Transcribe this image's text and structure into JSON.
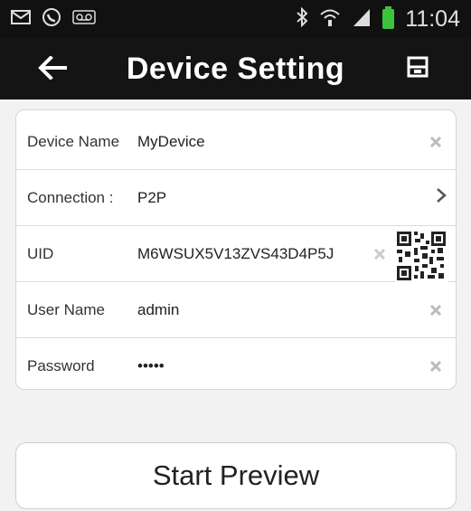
{
  "statusbar": {
    "time": "11:04",
    "icons": [
      "message-icon",
      "missed-call-icon",
      "voicemail-icon",
      "bluetooth-icon",
      "wifi-icon",
      "signal-icon",
      "battery-icon"
    ]
  },
  "header": {
    "title": "Device Setting",
    "back_icon": "arrow-left-icon",
    "save_icon": "save-icon"
  },
  "form": {
    "device_name": {
      "label": "Device Name",
      "value": "MyDevice"
    },
    "connection": {
      "label": "Connection  :",
      "value": "P2P"
    },
    "uid": {
      "label": "UID",
      "value": "M6WSUX5V13ZVS43D4P5J"
    },
    "user_name": {
      "label": "User Name",
      "value": "admin"
    },
    "password": {
      "label": "Password",
      "value": "•••••"
    }
  },
  "actions": {
    "start_preview": "Start Preview"
  },
  "colors": {
    "titlebar": "#141414",
    "background": "#f2f2f2",
    "battery": "#3cc43c"
  }
}
